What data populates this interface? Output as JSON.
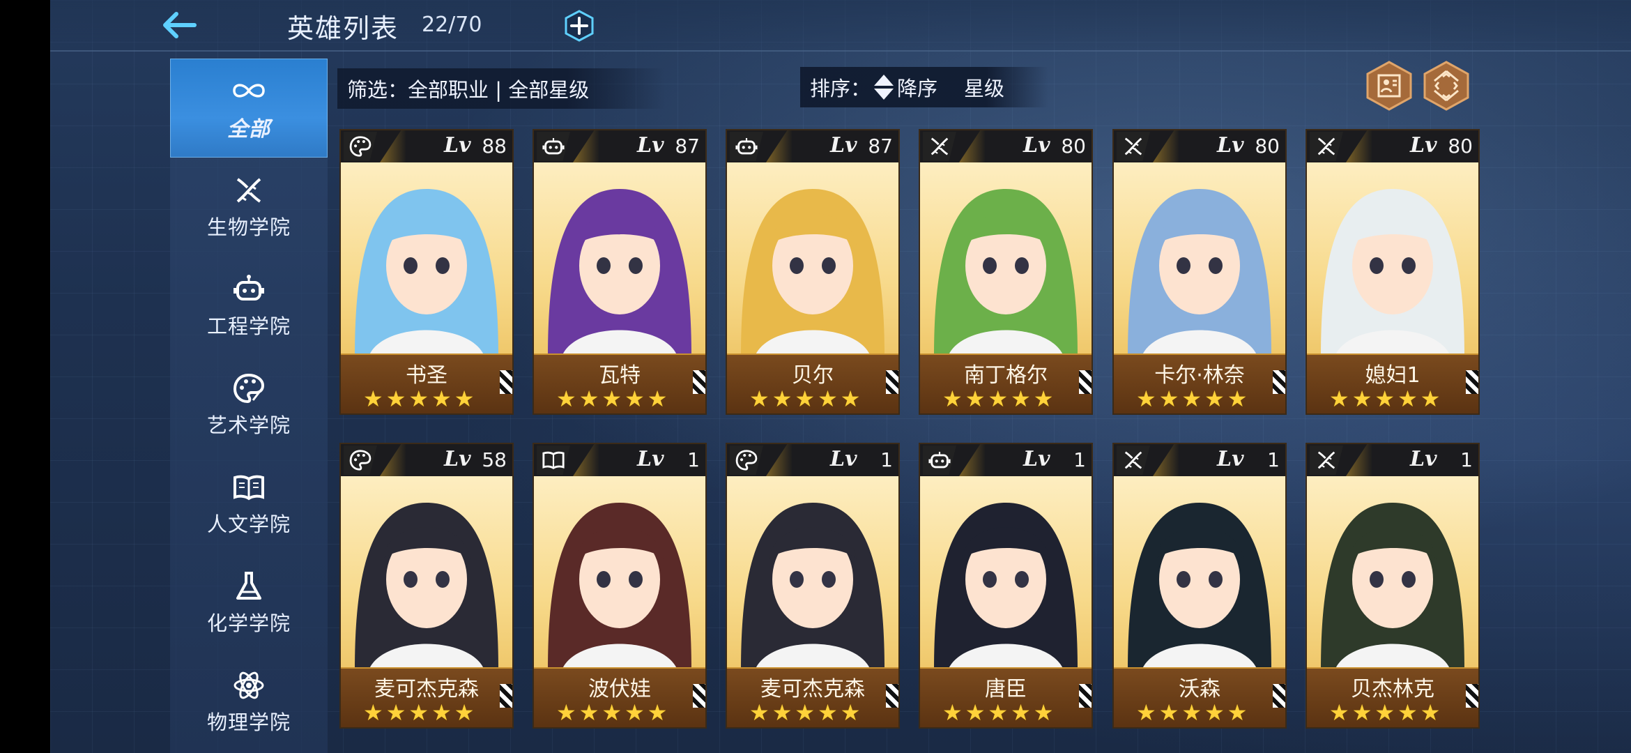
{
  "header": {
    "title": "英雄列表",
    "count": "22/70"
  },
  "sidebar": {
    "items": [
      {
        "label": "全部",
        "icon": "infinity-icon",
        "active": true
      },
      {
        "label": "生物学院",
        "icon": "dna-icon"
      },
      {
        "label": "工程学院",
        "icon": "robot-icon"
      },
      {
        "label": "艺术学院",
        "icon": "palette-icon"
      },
      {
        "label": "人文学院",
        "icon": "book-icon"
      },
      {
        "label": "化学学院",
        "icon": "flask-icon"
      },
      {
        "label": "物理学院",
        "icon": "atom-icon"
      }
    ]
  },
  "filter": {
    "label": "筛选：全部职业 | 全部星级"
  },
  "sort": {
    "label": "排序：",
    "direction": "降序",
    "key": "星级"
  },
  "level_prefix": "Lv",
  "heroes": [
    {
      "name": "书圣",
      "level": "88",
      "class_icon": "palette-icon",
      "stars": "★★★★★"
    },
    {
      "name": "瓦特",
      "level": "87",
      "class_icon": "robot-icon",
      "stars": "★★★★★"
    },
    {
      "name": "贝尔",
      "level": "87",
      "class_icon": "robot-icon",
      "stars": "★★★★★"
    },
    {
      "name": "南丁格尔",
      "level": "80",
      "class_icon": "dna-icon",
      "stars": "★★★★★"
    },
    {
      "name": "卡尔·林奈",
      "level": "80",
      "class_icon": "dna-icon",
      "stars": "★★★★★"
    },
    {
      "name": "媳妇1",
      "level": "80",
      "class_icon": "dna-icon",
      "stars": "★★★★★"
    },
    {
      "name": "麦可杰克森",
      "level": "58",
      "class_icon": "palette-icon",
      "stars": "★★★★★"
    },
    {
      "name": "波伏娃",
      "level": "1",
      "class_icon": "book-icon",
      "stars": "★★★★★"
    },
    {
      "name": "麦可杰克森",
      "level": "1",
      "class_icon": "palette-icon",
      "stars": "★★★★★"
    },
    {
      "name": "唐臣",
      "level": "1",
      "class_icon": "robot-icon",
      "stars": "★★★★★"
    },
    {
      "name": "沃森",
      "level": "1",
      "class_icon": "dna-icon",
      "stars": "★★★★★"
    },
    {
      "name": "贝杰林克",
      "level": "1",
      "class_icon": "dna-icon",
      "stars": "★★★★★"
    }
  ],
  "colors": {
    "accent": "#5fd0ff",
    "active_tab": "#2f80d2",
    "card_gold": "#f2cc6e",
    "name_bar": "#6a3d17",
    "star": "#ffd23a"
  }
}
